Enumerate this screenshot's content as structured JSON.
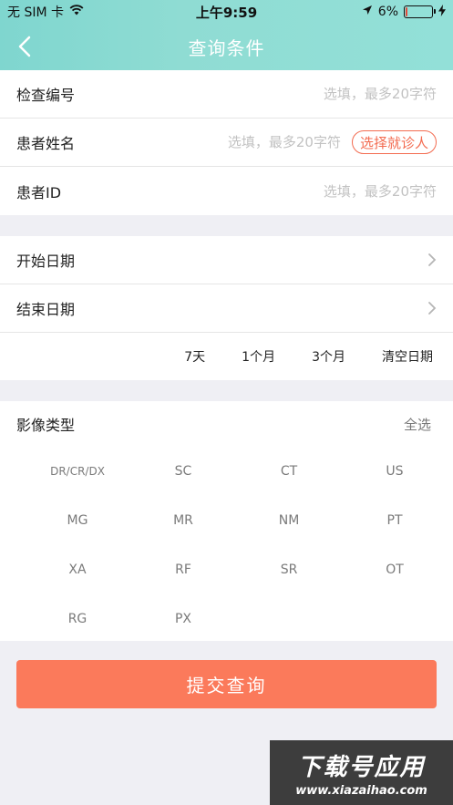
{
  "status_bar": {
    "carrier": "无 SIM 卡",
    "time": "上午9:59",
    "battery_text": "6%",
    "battery_level": 0.06,
    "battery_color": "#e34b3c"
  },
  "navbar": {
    "title": "查询条件",
    "back_icon": "chevron-left-icon"
  },
  "form": {
    "exam_no": {
      "label": "检查编号",
      "placeholder": "选填，最多20字符"
    },
    "patient_name": {
      "label": "患者姓名",
      "placeholder": "选填，最多20字符",
      "pick_label": "选择就诊人"
    },
    "patient_id": {
      "label": "患者ID",
      "placeholder": "选填，最多20字符"
    }
  },
  "dates": {
    "start_label": "开始日期",
    "end_label": "结束日期",
    "quick": [
      "7天",
      "1个月",
      "3个月",
      "清空日期"
    ]
  },
  "image_types": {
    "label": "影像类型",
    "select_all": "全选",
    "items": [
      "DR/CR/DX",
      "SC",
      "CT",
      "US",
      "MG",
      "MR",
      "NM",
      "PT",
      "XA",
      "RF",
      "SR",
      "OT",
      "RG",
      "PX"
    ]
  },
  "submit_label": "提交查询",
  "watermark": {
    "main": "下载号应用",
    "sub": "www.xiazaihao.com"
  },
  "colors": {
    "accent": "#fb7a5b",
    "header": "#8fdcd3",
    "pick_border": "#f36b50"
  }
}
